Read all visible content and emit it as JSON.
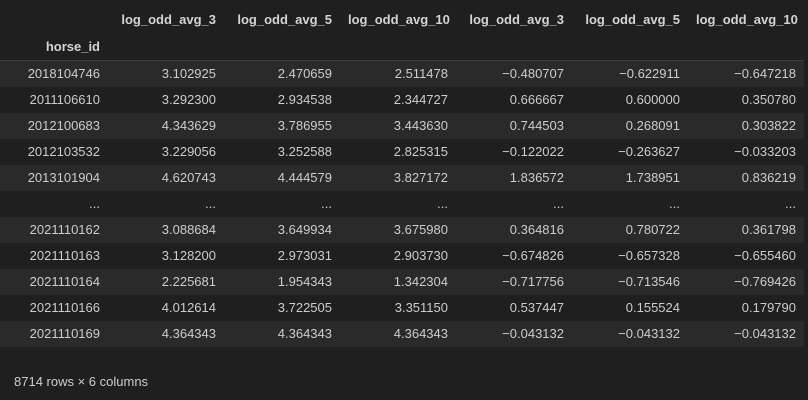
{
  "table": {
    "index_name": "horse_id",
    "columns": [
      "log_odd_avg_3",
      "log_odd_avg_5",
      "log_odd_avg_10",
      "log_odd_avg_3",
      "log_odd_avg_5",
      "log_odd_avg_10"
    ],
    "rows": [
      {
        "index": "2018104746",
        "values": [
          "3.102925",
          "2.470659",
          "2.511478",
          "−0.480707",
          "−0.622911",
          "−0.647218"
        ]
      },
      {
        "index": "2011106610",
        "values": [
          "3.292300",
          "2.934538",
          "2.344727",
          "0.666667",
          "0.600000",
          "0.350780"
        ]
      },
      {
        "index": "2012100683",
        "values": [
          "4.343629",
          "3.786955",
          "3.443630",
          "0.744503",
          "0.268091",
          "0.303822"
        ]
      },
      {
        "index": "2012103532",
        "values": [
          "3.229056",
          "3.252588",
          "2.825315",
          "−0.122022",
          "−0.263627",
          "−0.033203"
        ]
      },
      {
        "index": "2013101904",
        "values": [
          "4.620743",
          "4.444579",
          "3.827172",
          "1.836572",
          "1.738951",
          "0.836219"
        ]
      },
      {
        "index": "...",
        "values": [
          "...",
          "...",
          "...",
          "...",
          "...",
          "..."
        ]
      },
      {
        "index": "2021110162",
        "values": [
          "3.088684",
          "3.649934",
          "3.675980",
          "0.364816",
          "0.780722",
          "0.361798"
        ]
      },
      {
        "index": "2021110163",
        "values": [
          "3.128200",
          "2.973031",
          "2.903730",
          "−0.674826",
          "−0.657328",
          "−0.655460"
        ]
      },
      {
        "index": "2021110164",
        "values": [
          "2.225681",
          "1.954343",
          "1.342304",
          "−0.717756",
          "−0.713546",
          "−0.769426"
        ]
      },
      {
        "index": "2021110166",
        "values": [
          "4.012614",
          "3.722505",
          "3.351150",
          "0.537447",
          "0.155524",
          "0.179790"
        ]
      },
      {
        "index": "2021110169",
        "values": [
          "4.364343",
          "4.364343",
          "4.364343",
          "−0.043132",
          "−0.043132",
          "−0.043132"
        ]
      }
    ]
  },
  "shape_text": "8714 rows × 6 columns"
}
